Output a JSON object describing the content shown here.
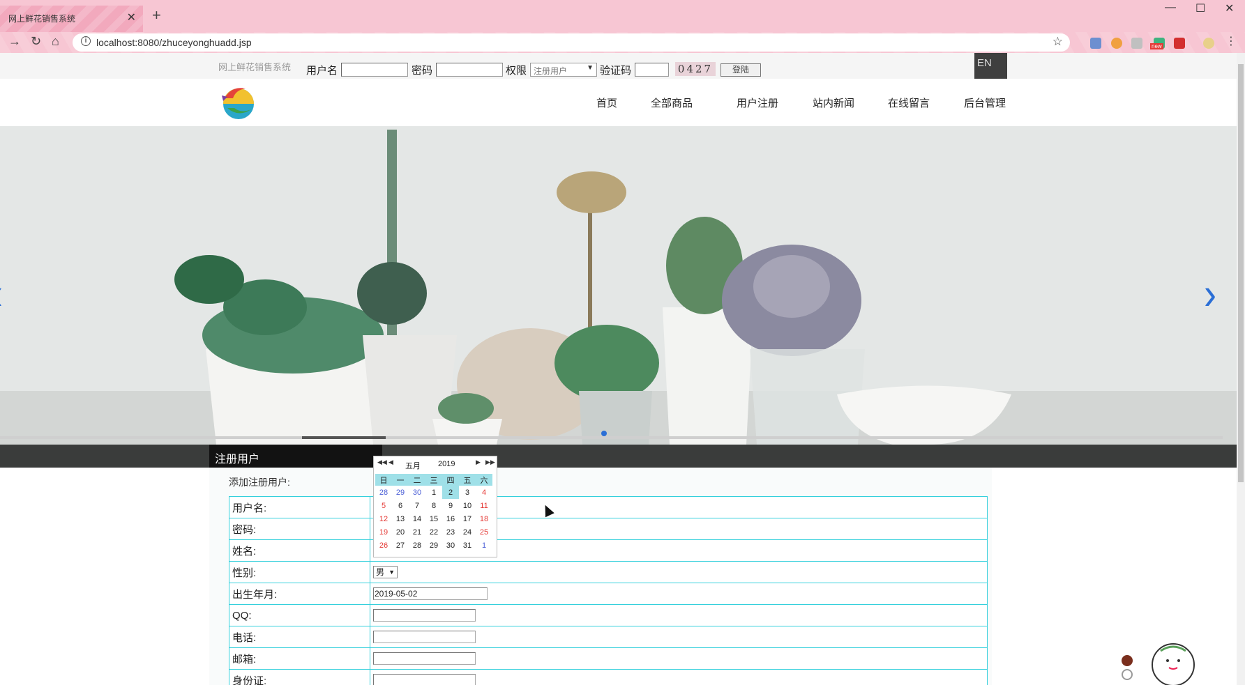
{
  "browser": {
    "tab_title": "网上鲜花销售系统",
    "url": "localhost:8080/zhuceyonghuadd.jsp",
    "ext_badge": "new"
  },
  "topbar": {
    "site_name": "网上鲜花销售系统",
    "username_label": "用户名",
    "password_label": "密码",
    "role_label": "权限",
    "role_selected": "注册用户",
    "captcha_label": "验证码",
    "captcha_code": "0427",
    "login_button": "登陆",
    "lang_button": "EN"
  },
  "nav": {
    "items": [
      "首页",
      "全部商品",
      "用户注册",
      "站内新闻",
      "在线留言",
      "后台管理"
    ]
  },
  "section": {
    "title": "注册用户",
    "caption": "添加注册用户:"
  },
  "form": {
    "fields": [
      {
        "label": "用户名:",
        "value": ""
      },
      {
        "label": "密码:",
        "value": ""
      },
      {
        "label": "姓名:",
        "value": ""
      },
      {
        "label": "性别:",
        "value": "男"
      },
      {
        "label": "出生年月:",
        "value": "2019-05-02"
      },
      {
        "label": "QQ:",
        "value": ""
      },
      {
        "label": "电话:",
        "value": ""
      },
      {
        "label": "邮箱:",
        "value": ""
      },
      {
        "label": "身份证:",
        "value": ""
      }
    ]
  },
  "calendar": {
    "month": "五月",
    "year": "2019",
    "weekdays": [
      "日",
      "一",
      "二",
      "三",
      "四",
      "五",
      "六"
    ],
    "rows": [
      [
        "28",
        "29",
        "30",
        "1",
        "2",
        "3",
        "4"
      ],
      [
        "5",
        "6",
        "7",
        "8",
        "9",
        "10",
        "11"
      ],
      [
        "12",
        "13",
        "14",
        "15",
        "16",
        "17",
        "18"
      ],
      [
        "19",
        "20",
        "21",
        "22",
        "23",
        "24",
        "25"
      ],
      [
        "26",
        "27",
        "28",
        "29",
        "30",
        "31",
        "1"
      ]
    ],
    "selected": "2"
  }
}
